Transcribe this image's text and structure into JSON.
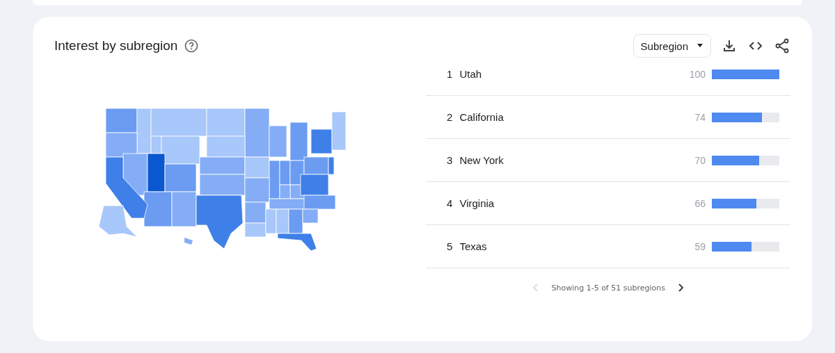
{
  "card": {
    "title": "Interest by subregion",
    "dropdown": {
      "value": "Subregion"
    }
  },
  "rows": [
    {
      "rank": "1",
      "name": "Utah",
      "value": "100",
      "level": 1
    },
    {
      "rank": "2",
      "name": "California",
      "value": "74",
      "level": 0.74
    },
    {
      "rank": "3",
      "name": "New York",
      "value": "70",
      "level": 0.7
    },
    {
      "rank": "4",
      "name": "Virginia",
      "value": "66",
      "level": 0.66
    },
    {
      "rank": "5",
      "name": "Texas",
      "value": "59",
      "level": 0.59
    }
  ],
  "pagination": {
    "text": "Showing 1-5 of 51 subregions",
    "prev_disabled": true,
    "next_disabled": false
  }
}
